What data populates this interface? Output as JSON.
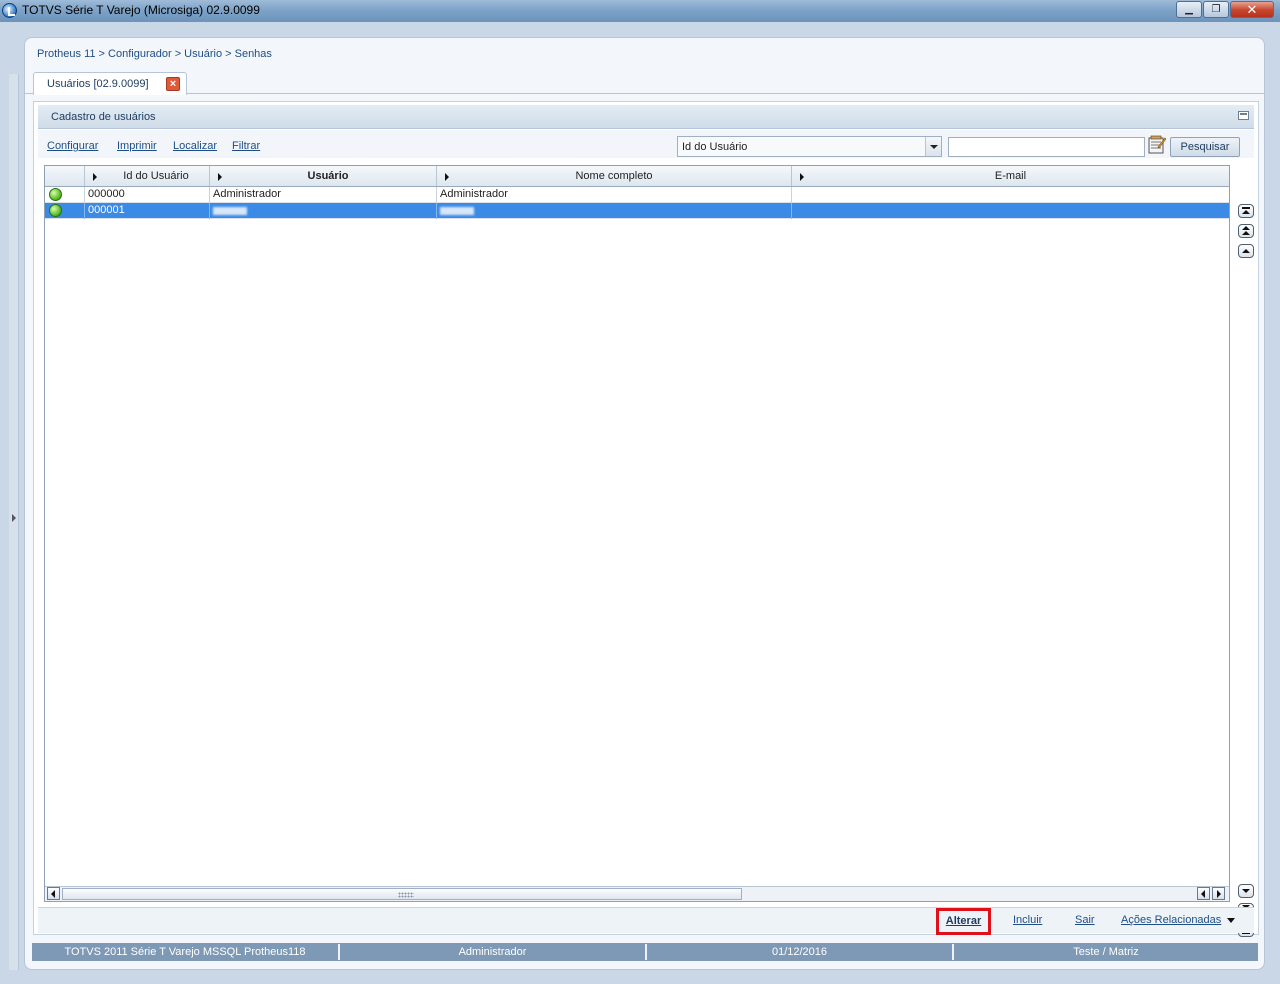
{
  "window": {
    "title": "TOTVS Série T Varejo (Microsiga) 02.9.0099",
    "controls": [
      "minimize",
      "restore",
      "close"
    ]
  },
  "breadcrumb": "Protheus 11 > Configurador > Usuário > Senhas",
  "tab": {
    "label": "Usuários [02.9.0099]"
  },
  "panel": {
    "title": "Cadastro de usuários"
  },
  "toolbar": {
    "links": [
      "Configurar",
      "Imprimir",
      "Localizar",
      "Filtrar"
    ],
    "search_field_selected": "Id do Usuário",
    "search_value": "",
    "search_button": "Pesquisar"
  },
  "grid": {
    "columns": [
      "Id do Usuário",
      "Usuário",
      "Nome completo",
      "E-mail"
    ],
    "rows": [
      {
        "status": "green",
        "id": "000000",
        "usuario": "Administrador",
        "nome": "Administrador",
        "email": ""
      },
      {
        "status": "green",
        "id": "000001",
        "usuario": "",
        "nome": "",
        "email": "",
        "selected": true
      }
    ]
  },
  "actions": {
    "alterar": "Alterar",
    "incluir": "Incluir",
    "sair": "Sair",
    "acoes": "Ações Relacionadas"
  },
  "statusbar": {
    "product": "TOTVS 2011 Série T Varejo MSSQL Protheus118",
    "user": "Administrador",
    "date": "01/12/2016",
    "environment": "Teste / Matriz"
  },
  "colors": {
    "selection": "#3b8ae6",
    "highlight_border": "#e0101b",
    "status_green": "#5fc02a"
  }
}
